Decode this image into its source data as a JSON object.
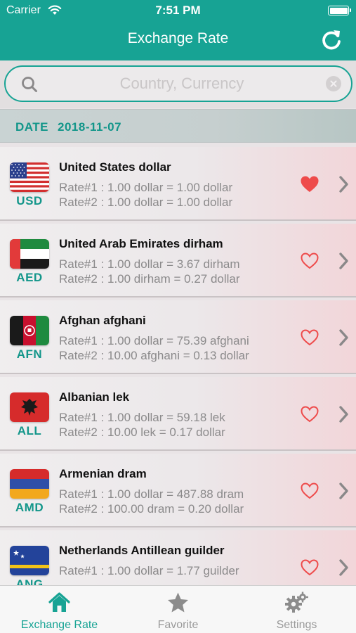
{
  "status_bar": {
    "carrier": "Carrier",
    "time": "7:51 PM"
  },
  "nav": {
    "title": "Exchange Rate",
    "refresh_icon": "refresh-icon"
  },
  "search": {
    "placeholder": "Country, Currency",
    "value": ""
  },
  "date_bar": {
    "label": "DATE",
    "value": "2018-11-07"
  },
  "currencies": [
    {
      "code": "USD",
      "name": "United States dollar",
      "rate1": "Rate#1 : 1.00 dollar = 1.00 dollar",
      "rate2": "Rate#2 : 1.00 dollar = 1.00 dollar",
      "favorite": true,
      "flag": "flag-usa"
    },
    {
      "code": "AED",
      "name": "United Arab Emirates dirham",
      "rate1": "Rate#1 : 1.00 dollar = 3.67 dirham",
      "rate2": "Rate#2 : 1.00 dirham = 0.27 dollar",
      "favorite": false,
      "flag": "flag-uae"
    },
    {
      "code": "AFN",
      "name": "Afghan afghani",
      "rate1": "Rate#1 : 1.00 dollar = 75.39 afghani",
      "rate2": "Rate#2 : 10.00 afghani = 0.13 dollar",
      "favorite": false,
      "flag": "flag-afghanistan"
    },
    {
      "code": "ALL",
      "name": "Albanian lek",
      "rate1": "Rate#1 : 1.00 dollar = 59.18 lek",
      "rate2": "Rate#2 : 10.00 lek = 0.17 dollar",
      "favorite": false,
      "flag": "flag-albania"
    },
    {
      "code": "AMD",
      "name": "Armenian dram",
      "rate1": "Rate#1 : 1.00 dollar = 487.88 dram",
      "rate2": "Rate#2 : 100.00 dram = 0.20 dollar",
      "favorite": false,
      "flag": "flag-armenia"
    },
    {
      "code": "ANG",
      "name": "Netherlands Antillean guilder",
      "rate1": "Rate#1 : 1.00 dollar = 1.77 guilder",
      "rate2": "",
      "favorite": false,
      "flag": "flag-curacao"
    }
  ],
  "tabs": [
    {
      "label": "Exchange Rate",
      "icon": "home-icon",
      "active": true
    },
    {
      "label": "Favorite",
      "icon": "star-icon",
      "active": false
    },
    {
      "label": "Settings",
      "icon": "gears-icon",
      "active": false
    }
  ],
  "colors": {
    "accent": "#17a394",
    "favorite": "#ee4b4b",
    "muted_text": "#8b8a8b",
    "inactive_tab": "#9b9b9b"
  }
}
